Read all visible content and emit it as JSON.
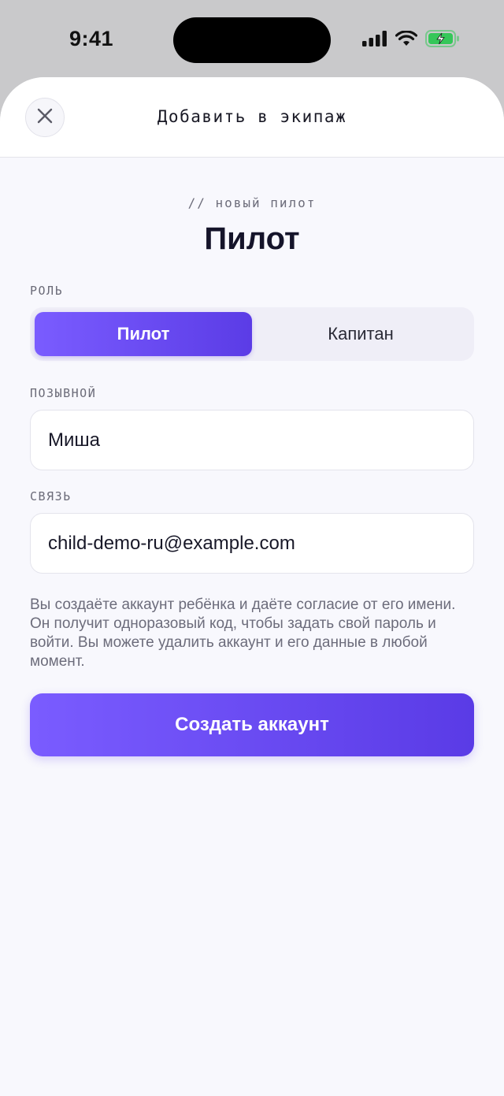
{
  "status_bar": {
    "time": "9:41"
  },
  "header": {
    "title": "Добавить в экипаж",
    "close_icon": "close-icon"
  },
  "intro": {
    "eyebrow": "// новый пилот",
    "title": "Пилот"
  },
  "role": {
    "label": "РОЛЬ",
    "options": [
      {
        "label": "Пилот",
        "selected": true
      },
      {
        "label": "Капитан",
        "selected": false
      }
    ]
  },
  "callsign": {
    "label": "ПОЗЫВНОЙ",
    "value": "Миша"
  },
  "contact": {
    "label": "СВЯЗЬ",
    "value": "child-demo-ru@example.com"
  },
  "consent": {
    "text": "Вы создаёте аккаунт ребёнка и даёте согласие от его имени. Он получит одноразовый код, чтобы задать свой пароль и войти. Вы можете удалить аккаунт и его данные в любой момент."
  },
  "actions": {
    "create_label": "Создать аккаунт"
  },
  "colors": {
    "accent": "#6a4cf2",
    "background": "#f8f8fd",
    "battery": "#35c759"
  }
}
